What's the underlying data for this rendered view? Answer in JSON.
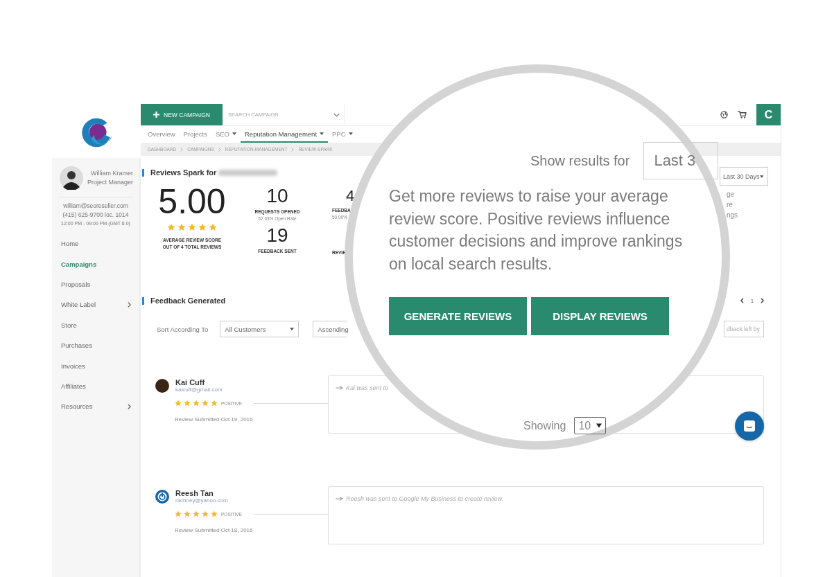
{
  "sidebar": {
    "profile": {
      "name": "William Kramer",
      "role": "Project Manager",
      "email": "william@seoreseller.com",
      "phone": "(415) 625-9700 loc. 1014",
      "hours": "12:00 PM - 09:00 PM (GMT 8.0)"
    },
    "items": [
      {
        "label": "Home",
        "selected": false,
        "has_submenu": false
      },
      {
        "label": "Campaigns",
        "selected": true,
        "has_submenu": false
      },
      {
        "label": "Proposals",
        "selected": false,
        "has_submenu": false
      },
      {
        "label": "White Label",
        "selected": false,
        "has_submenu": true
      },
      {
        "label": "Store",
        "selected": false,
        "has_submenu": false
      },
      {
        "label": "Purchases",
        "selected": false,
        "has_submenu": false
      },
      {
        "label": "Invoices",
        "selected": false,
        "has_submenu": false
      },
      {
        "label": "Affiliates",
        "selected": false,
        "has_submenu": false
      },
      {
        "label": "Resources",
        "selected": false,
        "has_submenu": true
      }
    ]
  },
  "topbar": {
    "new_campaign_button": "NEW CAMPAIGN",
    "search": {
      "placeholder": "SEARCH CAMPAIGN"
    },
    "user_initial": "C"
  },
  "nav_tabs": [
    {
      "label": "Overview",
      "selected": false,
      "has_menu": false
    },
    {
      "label": "Projects",
      "selected": false,
      "has_menu": false
    },
    {
      "label": "SEO",
      "selected": false,
      "has_menu": true
    },
    {
      "label": "Reputation Management",
      "selected": true,
      "has_menu": true
    },
    {
      "label": "PPC",
      "selected": false,
      "has_menu": true
    }
  ],
  "breadcrumb": [
    "DASHBOARD",
    "CAMPAIGNS",
    "REPUTATION-MANAGEMENT",
    "REVIEW-SPARK"
  ],
  "summary": {
    "title": "Reviews Spark for",
    "score": "5.00",
    "stars": 5,
    "score_label": [
      "AVERAGE REVIEW SCORE",
      "OUT OF 4 TOTAL REVIEWS"
    ],
    "stats": [
      {
        "value": "10",
        "label": "REQUESTS OPENED",
        "sub": "52.63% Open Rate"
      },
      {
        "value": "19",
        "label": "FEEDBACK SENT"
      }
    ],
    "partial_column": {
      "value": "4",
      "label": "FEEDBA",
      "sub": "50.00%",
      "label_2": "REVIE"
    }
  },
  "period_select": {
    "value": "Last 30 Days"
  },
  "side_text_fragments": [
    "ge",
    "re",
    "ngs"
  ],
  "feedback": {
    "title": "Feedback Generated",
    "page": "1",
    "sort_label": "Sort According To",
    "filters": [
      {
        "value": "All Customers",
        "has_caret": true
      },
      {
        "value": "Ascending",
        "has_caret": false
      }
    ],
    "search": {
      "placeholder": "dback left by"
    },
    "reviews": [
      {
        "name": "Kai Cuff",
        "email": "kaicuff@gmail.com",
        "kind": "photo",
        "stars": 5,
        "sentiment": "POSITIVE",
        "submitted": "Review Submitted Oct 19, 2016",
        "message": "Kai was sent to"
      },
      {
        "name": "Reesh Tan",
        "email": "rachney@yahoo.com",
        "kind": "logo",
        "stars": 5,
        "sentiment": "POSITIVE",
        "submitted": "Review Submitted Oct 18, 2016",
        "message": "Reesh was sent to Google My Business to create review."
      }
    ]
  },
  "magnifier": {
    "show_results_label": "Show results for",
    "period_value": "Last 3",
    "description": "Get more reviews to raise your average review score. Positive reviews influence customer decisions and improve rankings on local search results.",
    "buttons": [
      "GENERATE REVIEWS",
      "DISPLAY REVIEWS"
    ],
    "showing_label": "Showing",
    "page_size": "10"
  }
}
